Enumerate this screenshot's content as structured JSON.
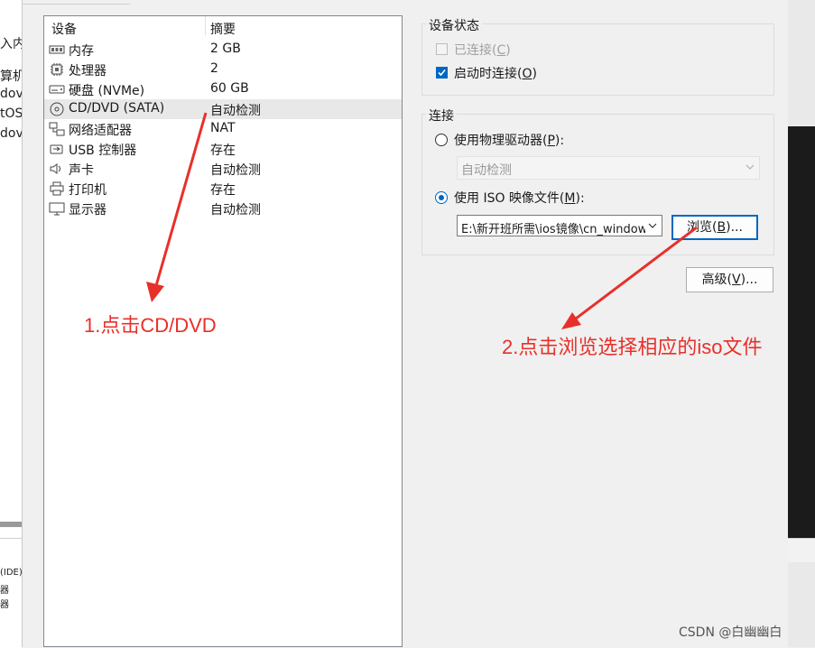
{
  "background": {
    "left_fragments": [
      "入内",
      "算机",
      "dov",
      "tOS",
      "dov"
    ],
    "left_lower_fragments": [
      "(IDE)",
      "器",
      "器"
    ]
  },
  "device_list": {
    "headers": {
      "device": "设备",
      "summary": "摘要"
    },
    "rows": [
      {
        "icon": "memory-icon",
        "name": "内存",
        "summary": "2 GB",
        "selected": false
      },
      {
        "icon": "processor-icon",
        "name": "处理器",
        "summary": "2",
        "selected": false
      },
      {
        "icon": "hard-disk-icon",
        "name": "硬盘 (NVMe)",
        "summary": "60 GB",
        "selected": false
      },
      {
        "icon": "cd-dvd-icon",
        "name": "CD/DVD (SATA)",
        "summary": "自动检测",
        "selected": true
      },
      {
        "icon": "network-adapter-icon",
        "name": "网络适配器",
        "summary": "NAT",
        "selected": false
      },
      {
        "icon": "usb-controller-icon",
        "name": "USB 控制器",
        "summary": "存在",
        "selected": false
      },
      {
        "icon": "sound-card-icon",
        "name": "声卡",
        "summary": "自动检测",
        "selected": false
      },
      {
        "icon": "printer-icon",
        "name": "打印机",
        "summary": "存在",
        "selected": false
      },
      {
        "icon": "display-icon",
        "name": "显示器",
        "summary": "自动检测",
        "selected": false
      }
    ]
  },
  "device_status": {
    "title": "设备状态",
    "connected": {
      "label": "已连接(",
      "key": "C",
      "suffix": ")",
      "checked": false,
      "enabled": false
    },
    "connect_at_power_on": {
      "label": "启动时连接(",
      "key": "O",
      "suffix": ")",
      "checked": true,
      "enabled": true
    }
  },
  "connection": {
    "title": "连接",
    "physical_drive": {
      "label": "使用物理驱动器(",
      "key": "P",
      "suffix": "):",
      "selected": false
    },
    "physical_drive_value": "自动检测",
    "iso_image": {
      "label": "使用 ISO 映像文件(",
      "key": "M",
      "suffix": "):",
      "selected": true
    },
    "iso_path": "E:\\新开班所需\\ios镜像\\cn_windows",
    "browse_button": {
      "label": "浏览(",
      "key": "B",
      "suffix": ")..."
    }
  },
  "advanced_button": {
    "label": "高级(",
    "key": "V",
    "suffix": ")..."
  },
  "annotations": {
    "step1": "1.点击CD/DVD",
    "step2": "2.点击浏览选择相应的iso文件"
  },
  "watermark": "CSDN @白幽幽白",
  "colors": {
    "accent": "#0067c0",
    "annotation": "#e8302a"
  }
}
